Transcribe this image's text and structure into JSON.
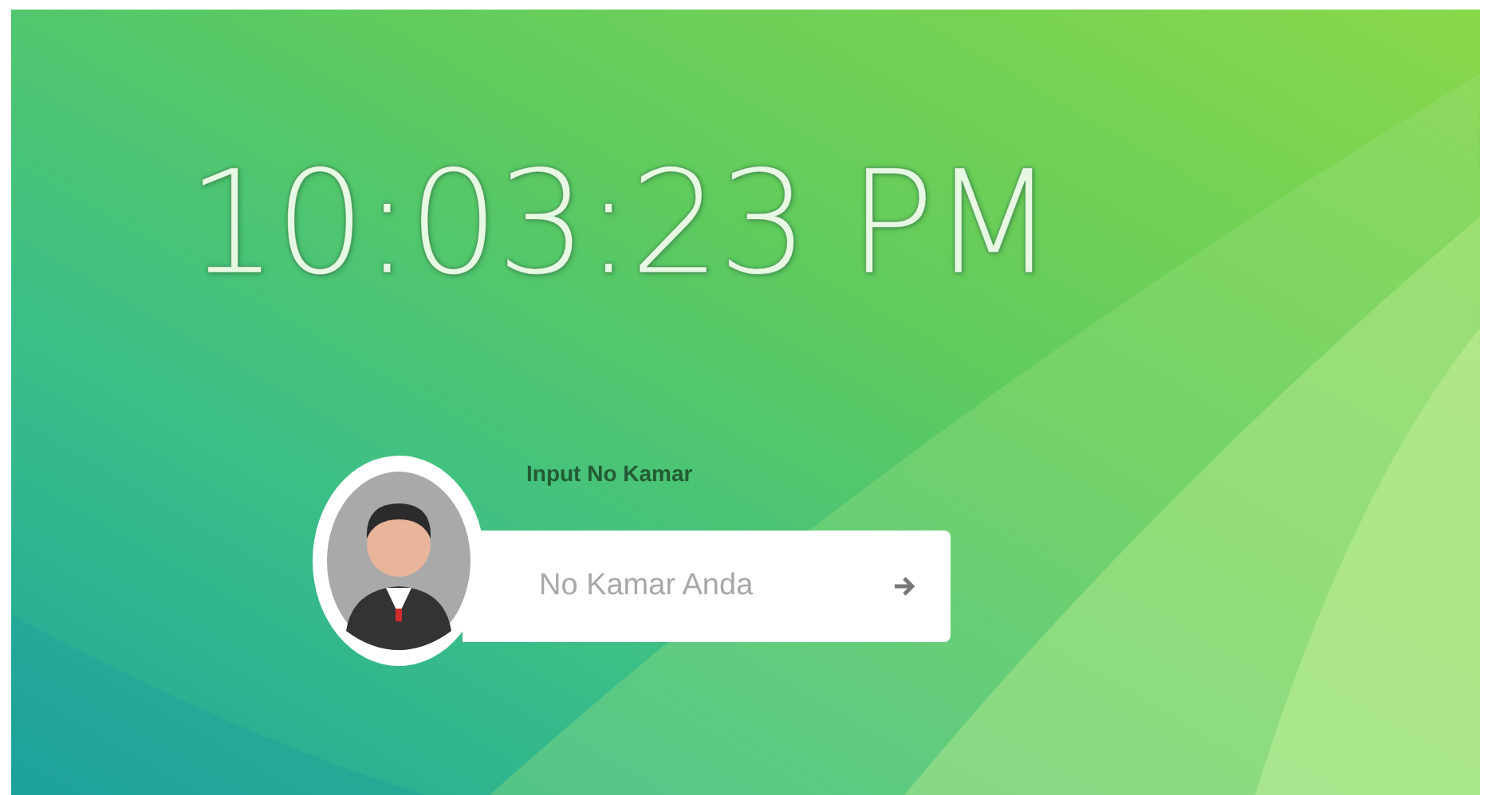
{
  "clock": {
    "time": "10:03:23 PM"
  },
  "login": {
    "label": "Input No Kamar",
    "placeholder": "No Kamar Anda"
  }
}
